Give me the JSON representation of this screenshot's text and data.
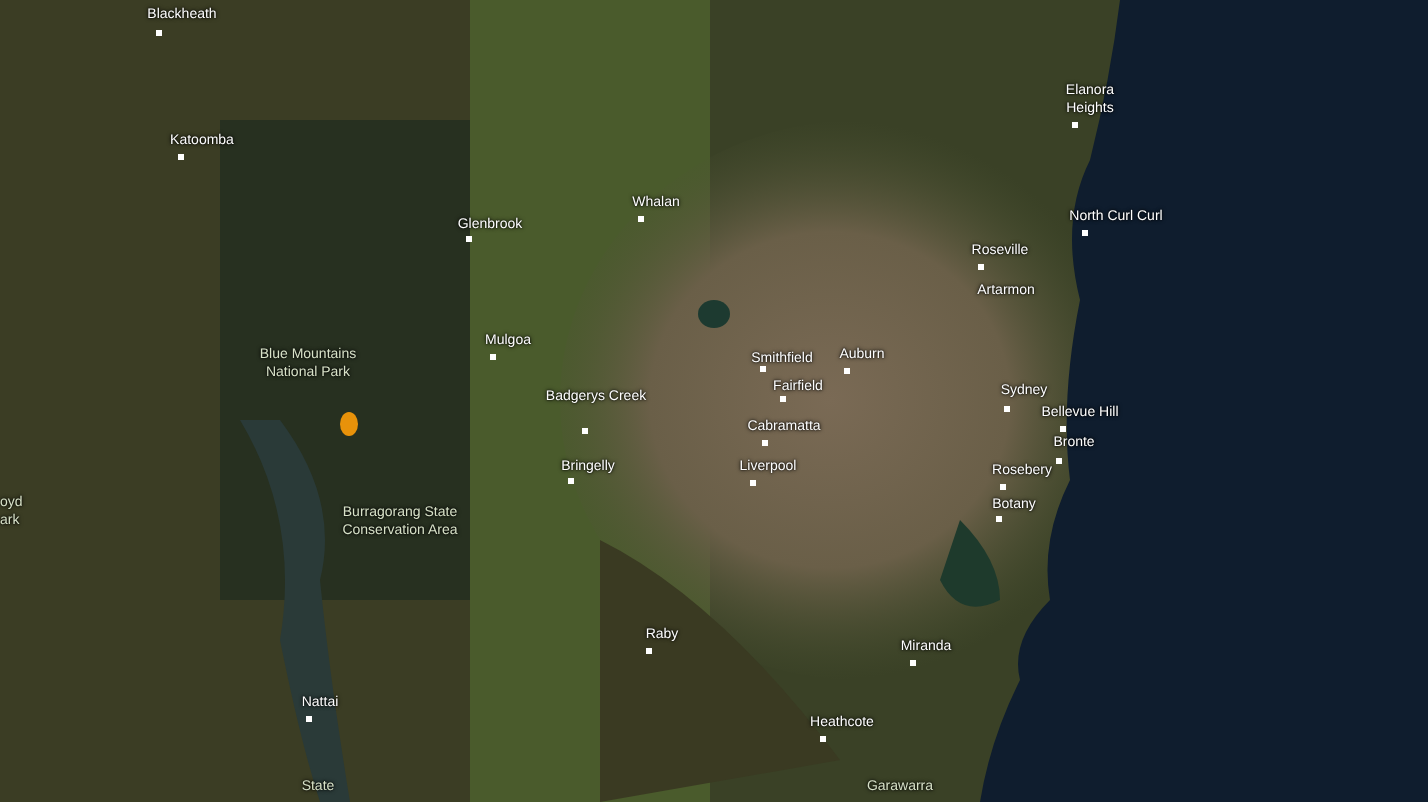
{
  "map": {
    "labels": [
      {
        "kind": "town",
        "text": "Blackheath"
      },
      {
        "kind": "town",
        "text": "Katoomba"
      },
      {
        "kind": "town",
        "text": "Glenbrook"
      },
      {
        "kind": "town",
        "text": "Whalan"
      },
      {
        "kind": "area",
        "text": "Blue Mountains National Park"
      },
      {
        "kind": "town",
        "text": "Mulgoa"
      },
      {
        "kind": "town",
        "text": "Smithfield"
      },
      {
        "kind": "town",
        "text": "Auburn"
      },
      {
        "kind": "town",
        "text": "Fairfield"
      },
      {
        "kind": "town",
        "text": "Badgerys Creek"
      },
      {
        "kind": "town",
        "text": "Cabramatta"
      },
      {
        "kind": "town",
        "text": "Bringelly"
      },
      {
        "kind": "town",
        "text": "Liverpool"
      },
      {
        "kind": "area",
        "text": "oyd ark"
      },
      {
        "kind": "area",
        "text": "Burragorang State Conservation Area"
      },
      {
        "kind": "town",
        "text": "Elanora Heights"
      },
      {
        "kind": "town",
        "text": "North Curl Curl"
      },
      {
        "kind": "town",
        "text": "Roseville"
      },
      {
        "kind": "town",
        "text": "Artarmon"
      },
      {
        "kind": "town",
        "text": "Sydney"
      },
      {
        "kind": "town",
        "text": "Bellevue Hill"
      },
      {
        "kind": "town",
        "text": "Bronte"
      },
      {
        "kind": "town",
        "text": "Rosebery"
      },
      {
        "kind": "town",
        "text": "Botany"
      },
      {
        "kind": "town",
        "text": "Raby"
      },
      {
        "kind": "town",
        "text": "Miranda"
      },
      {
        "kind": "town",
        "text": "Nattai"
      },
      {
        "kind": "town",
        "text": "Heathcote"
      },
      {
        "kind": "area",
        "text": "State"
      },
      {
        "kind": "area",
        "text": "Garawarra"
      }
    ]
  }
}
